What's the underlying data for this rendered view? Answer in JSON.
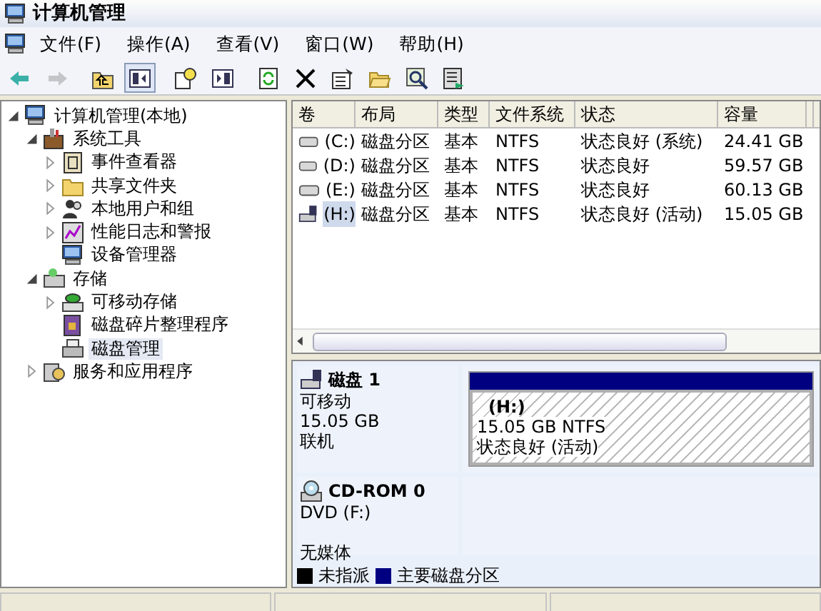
{
  "window": {
    "title": "计算机管理"
  },
  "menu": [
    {
      "label": "文件(F)"
    },
    {
      "label": "操作(A)"
    },
    {
      "label": "查看(V)"
    },
    {
      "label": "窗口(W)"
    },
    {
      "label": "帮助(H)"
    }
  ],
  "toolbar": [
    {
      "kind": "back",
      "disabled": false,
      "pressed": false
    },
    {
      "kind": "forward",
      "disabled": true,
      "pressed": false
    },
    {
      "kind": "up",
      "disabled": false,
      "pressed": false
    },
    {
      "kind": "tree",
      "disabled": false,
      "pressed": true
    },
    {
      "kind": "help",
      "disabled": false,
      "pressed": false
    },
    {
      "kind": "pane",
      "disabled": false,
      "pressed": false
    },
    {
      "kind": "refresh",
      "disabled": false,
      "pressed": false
    },
    {
      "kind": "delete",
      "disabled": false,
      "pressed": false
    },
    {
      "kind": "properties",
      "disabled": false,
      "pressed": false
    },
    {
      "kind": "open",
      "disabled": false,
      "pressed": false
    },
    {
      "kind": "search",
      "disabled": false,
      "pressed": false
    },
    {
      "kind": "export",
      "disabled": false,
      "pressed": false
    }
  ],
  "tree": [
    {
      "label": "计算机管理(本地)",
      "kind": "computer",
      "expanded": true,
      "selected": false,
      "children": [
        {
          "label": "系统工具",
          "kind": "tools",
          "expanded": true,
          "selected": false,
          "children": [
            {
              "label": "事件查看器",
              "kind": "event",
              "expanded": false,
              "selected": false
            },
            {
              "label": "共享文件夹",
              "kind": "folder",
              "expanded": false,
              "selected": false
            },
            {
              "label": "本地用户和组",
              "kind": "users",
              "expanded": false,
              "selected": false
            },
            {
              "label": "性能日志和警报",
              "kind": "perf",
              "expanded": false,
              "selected": false
            },
            {
              "label": "设备管理器",
              "kind": "computer",
              "selected": false
            }
          ]
        },
        {
          "label": "存储",
          "kind": "storage",
          "expanded": true,
          "selected": false,
          "children": [
            {
              "label": "可移动存储",
              "kind": "removable",
              "expanded": false,
              "selected": false
            },
            {
              "label": "磁盘碎片整理程序",
              "kind": "defrag",
              "selected": false
            },
            {
              "label": "磁盘管理",
              "kind": "disk",
              "selected": true
            }
          ]
        },
        {
          "label": "服务和应用程序",
          "kind": "services",
          "expanded": false,
          "selected": false
        }
      ]
    }
  ],
  "volumes": {
    "columns": [
      "卷",
      "布局",
      "类型",
      "文件系统",
      "状态",
      "容量"
    ],
    "rows": [
      {
        "kind": "fixed",
        "selected": false,
        "cells": [
          "(C:)",
          "磁盘分区",
          "基本",
          "NTFS",
          "状态良好 (系统)",
          "24.41 GB"
        ]
      },
      {
        "kind": "fixed",
        "selected": false,
        "cells": [
          "(D:)",
          "磁盘分区",
          "基本",
          "NTFS",
          "状态良好",
          "59.57 GB"
        ]
      },
      {
        "kind": "fixed",
        "selected": false,
        "cells": [
          "(E:)",
          "磁盘分区",
          "基本",
          "NTFS",
          "状态良好",
          "60.13 GB"
        ]
      },
      {
        "kind": "removable",
        "selected": true,
        "cells": [
          "(H:)",
          "磁盘分区",
          "基本",
          "NTFS",
          "状态良好 (活动)",
          "15.05 GB"
        ]
      }
    ]
  },
  "disks": [
    {
      "kind": "removable",
      "name": "磁盘 1",
      "lines": [
        "可移动",
        "15.05 GB",
        "联机"
      ],
      "partitions": [
        {
          "label": "(H:)",
          "size": "15.05 GB NTFS",
          "status": "状态良好 (活动)",
          "selected": true,
          "color": "#000080"
        }
      ]
    },
    {
      "kind": "cdrom",
      "name": "CD-ROM 0",
      "lines": [
        "DVD (F:)",
        "无媒体"
      ]
    }
  ],
  "legend": [
    {
      "label": "未指派",
      "color": "#000000"
    },
    {
      "label": "主要磁盘分区",
      "color": "#000080"
    }
  ]
}
